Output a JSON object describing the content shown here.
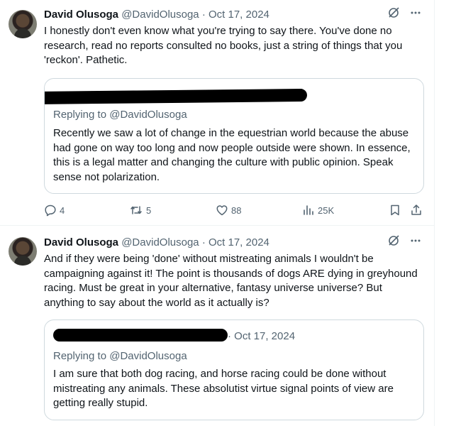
{
  "tweets": [
    {
      "author_name": "David Olusoga",
      "author_handle": "@DavidOlusoga",
      "separator": "·",
      "date": "Oct 17, 2024",
      "text": "I honestly don't even know what you're trying to say there. You've done no research, read no reports consulted no books, just a string of things that you 'reckon'. Pathetic.",
      "quote": {
        "replying_to": "Replying to @DavidOlusoga",
        "text": "Recently we saw a lot of change in the equestrian world because the abuse had gone on way too long and now people outside were shown. In essence, this is a legal matter and changing the culture with public opinion. Speak sense not polarization."
      },
      "actions": {
        "replies": "4",
        "reposts": "5",
        "likes": "88",
        "views": "25K"
      }
    },
    {
      "author_name": "David Olusoga",
      "author_handle": "@DavidOlusoga",
      "separator": "·",
      "date": "Oct 17, 2024",
      "text": "And if they were being 'done' without mistreating animals I wouldn't be campaigning against it! The point is thousands of dogs ARE dying in greyhound racing. Must be great in your alternative, fantasy universe universe? But anything to say about the world as it actually is?",
      "quote": {
        "date": "· Oct 17, 2024",
        "replying_to": "Replying to @DavidOlusoga",
        "text": "I am sure that both dog racing, and horse racing could be done without mistreating any animals. These absolutist virtue signal points of view are getting really stupid."
      }
    }
  ],
  "icons": {
    "grok": "grok-icon",
    "more": "more-options-icon",
    "reply": "reply-icon",
    "repost": "repost-icon",
    "like": "heart-icon",
    "views": "views-icon",
    "bookmark": "bookmark-icon",
    "share": "share-icon"
  },
  "colors": {
    "text": "#0f1419",
    "secondary": "#536471",
    "border": "#cfd9de",
    "divider": "#eff3f4"
  }
}
